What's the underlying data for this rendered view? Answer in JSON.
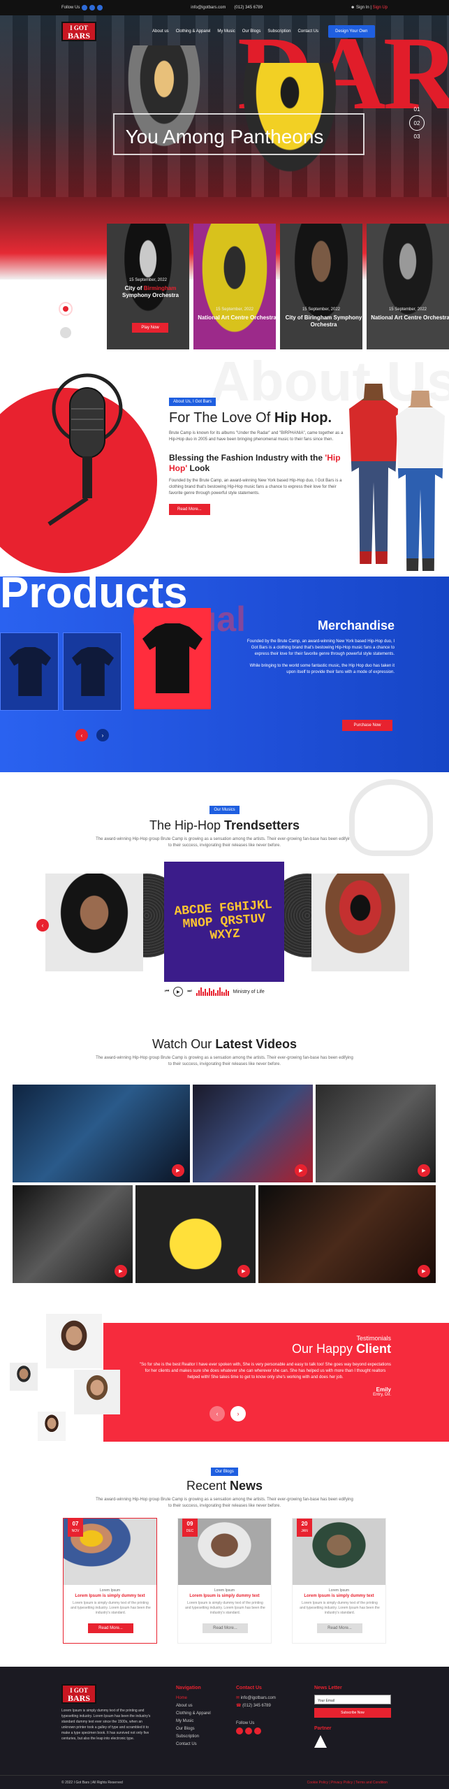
{
  "topbar": {
    "follow": "Follow Us",
    "email": "info@igotbars.com",
    "phone": "(012) 345 6789",
    "signin": "Sign In",
    "signup": "Sign Up"
  },
  "brand": {
    "logo_line1": "I GOT",
    "logo_line2": "BARS"
  },
  "nav": {
    "items": [
      "About us",
      "Clothing & Apparel",
      "My Music",
      "Our Blogs",
      "Subscription",
      "Contact Us"
    ],
    "cta": "Design Your Own"
  },
  "hero": {
    "bg_text": "DAR",
    "title": "You Among Pantheons",
    "counter_prev": "01",
    "counter_current": "02",
    "counter_next": "03"
  },
  "events": [
    {
      "date": "15 September, 2022",
      "title_a": "City of ",
      "title_b": "Birmingham",
      "title_c": " Symphony Orchestra",
      "button": "Play Now"
    },
    {
      "date": "15 September, 2022",
      "title": "National Art Centre Orchestra"
    },
    {
      "date": "15 September, 2022",
      "title": "City of Biringham Symphony Orchestra"
    },
    {
      "date": "15 September, 2022",
      "title": "National Art Centre Orchestra"
    }
  ],
  "about": {
    "watermark": "About Us",
    "badge": "About Us, I Got Bars",
    "heading": "For The Love Of ",
    "heading_bold": "Hip Hop.",
    "para1": "Brute Camp is known for its albums \"Under the Radar\" and \"BIRPHANIA\", came together as a Hip-Hop duo in 2005 and have been bringing phenomenal music to their fans since then.",
    "sub_heading_a": "Blessing the Fashion Industry with the ",
    "sub_heading_b": "'Hip Hop'",
    "sub_heading_c": " Look",
    "para2": "Founded by the Brute Camp, an award-winning New York based Hip-Hop duo, I Got Bars is a clothing brand that's bestowing Hip-Hop music fans a chance to express their love for their favorite genre through powerful style statements.",
    "button": "Read More..."
  },
  "products": {
    "title": "Products",
    "bg_word": "Casual",
    "merch_title": "Merchandise",
    "para1": "Founded by the Brute Camp, an award-winning New York based Hip-Hop duo, I Got Bars is a clothing brand that's bestowing Hip-Hop music fans a chance to express their love for their favorite genre through powerful style statements.",
    "para2": "While bringing to the world some fantastic music, the Hip Hop duo has taken it upon itself to provide their fans with a mode of expression.",
    "button": "Purchase Now",
    "prev": "‹",
    "next": "›"
  },
  "music": {
    "badge": "Our Musics",
    "title_a": "The Hip-Hop ",
    "title_b": "Trendsetters",
    "sub": "The award-winning Hip-Hop group Brute Camp is growing as a sensation among the artists. Their ever-growing fan-base has been edifying to their success, invigorating their releases like never before.",
    "album_art": "ABCDE FGHIJKL MNOP QRSTUV WXYZ",
    "track": "Ministry of Life",
    "controls": [
      "⏮",
      "▶",
      "⏭"
    ]
  },
  "videos": {
    "title_a": "Watch Our ",
    "title_b": "Latest Videos",
    "sub": "The award-winning Hip-Hop group Brute Camp is growing as a sensation among the artists. Their ever-growing fan-base has been edifying to their success, invigorating their releases like never before."
  },
  "testimonials": {
    "kicker": "Testimonials",
    "title_a": "Our Happy ",
    "title_b": "Client",
    "quote": "\"So for she is the best Realtor I have ever spoken with, She is very personable and easy to talk too! She goes way beyond expectations for her clients and makes sure she does whatever she can wherever she can. She has helped us with more than I thought realtors helped with! She takes time to get to know only she's working with and does her job.",
    "name": "Emily",
    "role": "Entry, Dir."
  },
  "news": {
    "badge": "Our Blogs",
    "title_a": "Recent ",
    "title_b": "News",
    "sub": "The award-winning Hip-Hop group Brute Camp is growing as a sensation among the artists. Their ever-growing fan-base has been edifying to their success, invigorating their releases like never before.",
    "cards": [
      {
        "day": "07",
        "mon": "NOV",
        "label": "Lorem Ipsum",
        "title": "Lorem Ipsum is simply dummy text",
        "desc": "Lorem Ipsum is simply dummy text of the printing and typesetting industry. Lorem Ipsum has been the industry's standard.",
        "button": "Read More..."
      },
      {
        "day": "09",
        "mon": "DEC",
        "label": "Lorem Ipsum",
        "title": "Lorem Ipsum is simply dummy text",
        "desc": "Lorem Ipsum is simply dummy text of the printing and typesetting industry. Lorem Ipsum has been the industry's standard.",
        "button": "Read More..."
      },
      {
        "day": "20",
        "mon": "JAN",
        "label": "Lorem Ipsum",
        "title": "Lorem Ipsum is simply dummy text",
        "desc": "Lorem Ipsum is simply dummy text of the printing and typesetting industry. Lorem Ipsum has been the industry's standard.",
        "button": "Read More..."
      }
    ]
  },
  "footer": {
    "about": "Lorem Ipsum is simply dummy text of the printing and typesetting industry. Lorem Ipsum has been the industry's standard dummy text ever since the 1500s, when an unknown printer took a galley of type and scrambled it to make a type specimen book. It has survived not only five centuries, but also the leap into electronic type.",
    "nav_title": "Navigation",
    "nav_items": [
      "Home",
      "About us",
      "Clothing & Apparel",
      "My Music",
      "Our Blogs",
      "Subscription",
      "Contact Us"
    ],
    "contact_title": "Contact Us",
    "contact_email": "info@igotbars.com",
    "contact_phone": "(012) 345 6789",
    "follow": "Follow Us",
    "newsletter_title": "News Letter",
    "email_placeholder": "Your Email",
    "subscribe": "Subscribe Now",
    "partner": "Partner",
    "copyright": "© 2022 I Got Bars | All Rights Reserved",
    "links": "Cookie Policy  |  Privacy Policy  |  Terms and Condition"
  },
  "colors": {
    "accent": "#e8222f",
    "blue": "#1f5fe0",
    "dark": "#1b1a22"
  }
}
